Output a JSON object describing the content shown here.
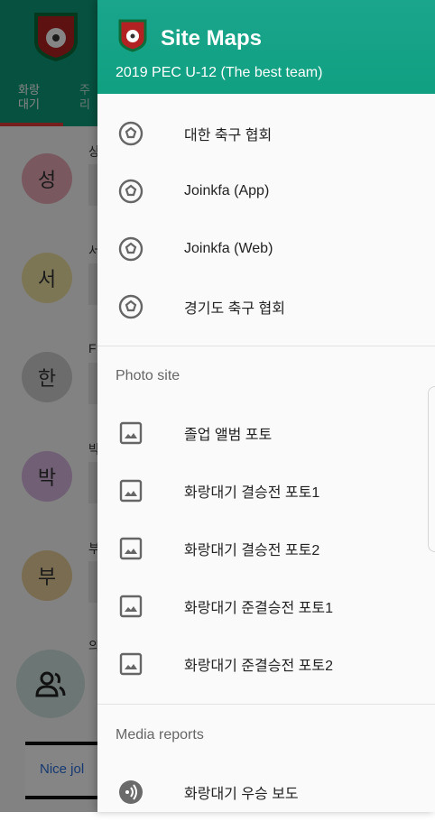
{
  "background": {
    "tabs": [
      "화랑\n대기",
      "주\n리"
    ],
    "avatars": [
      "성",
      "서",
      "한",
      "박",
      "부"
    ],
    "row_letters": [
      "상",
      "서",
      "F",
      "박",
      "부",
      "의"
    ],
    "bottom_text": "Nice jol"
  },
  "drawer": {
    "title": "Site Maps",
    "subtitle": "2019 PEC U-12 (The best team)",
    "links": [
      {
        "label": "대한 축구 협회",
        "icon": "soccer-ball-icon"
      },
      {
        "label": "Joinkfa (App)",
        "icon": "soccer-ball-icon"
      },
      {
        "label": "Joinkfa (Web)",
        "icon": "soccer-ball-icon"
      },
      {
        "label": "경기도 축구 협회",
        "icon": "soccer-ball-icon"
      }
    ],
    "photo_section_title": "Photo site",
    "photos": [
      {
        "label": "졸업 앨범 포토",
        "icon": "image-icon"
      },
      {
        "label": "화랑대기 결승전 포토1",
        "icon": "image-icon"
      },
      {
        "label": "화랑대기 결승전 포토2",
        "icon": "image-icon"
      },
      {
        "label": "화랑대기 준결승전 포토1",
        "icon": "image-icon"
      },
      {
        "label": "화랑대기 준결승전 포토2",
        "icon": "image-icon"
      }
    ],
    "media_section_title": "Media reports",
    "media": [
      {
        "label": "화랑대기 우승 보도",
        "icon": "podcast-icon"
      }
    ]
  },
  "colors": {
    "header": "#10a081",
    "scrim": "rgba(0,0,0,0.48)",
    "bottom_text": "#2b6ed8"
  }
}
